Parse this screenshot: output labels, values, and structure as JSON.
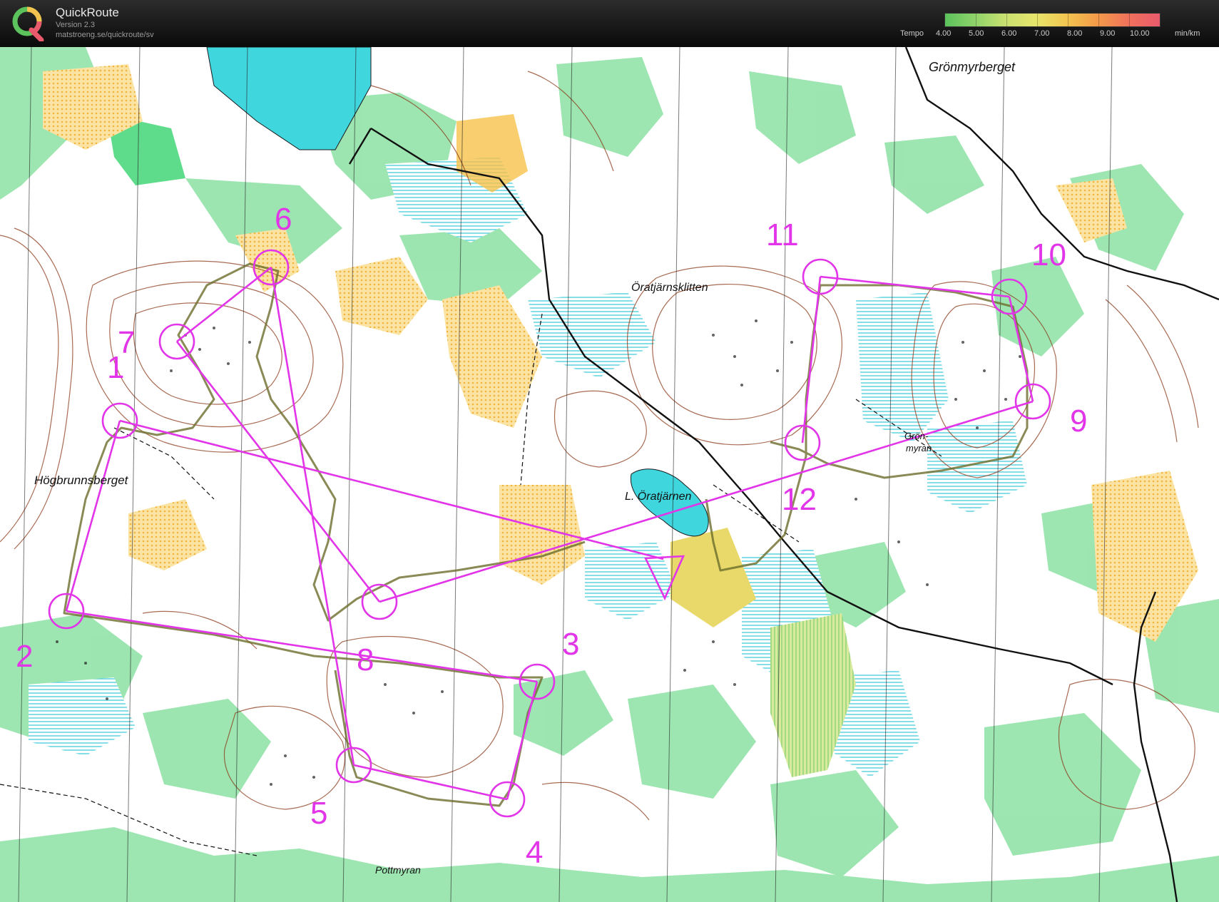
{
  "app": {
    "name": "QuickRoute",
    "version": "Version 2.3",
    "url": "matstroeng.se/quickroute/sv"
  },
  "legend": {
    "title": "Tempo",
    "labels": [
      "4.00",
      "5.00",
      "6.00",
      "7.00",
      "8.00",
      "9.00",
      "10.00"
    ],
    "unit": "min/km"
  },
  "colors": {
    "course": "#e234e8",
    "water": "#3fd6de",
    "open_land": "#f7c24a",
    "vegetation": "#92e3a9",
    "contour": "#8b3a1a"
  },
  "place_names": {
    "gronmyrberget": "Grönmyrberget",
    "oratjarnsklitten": "Öratjärnsklitten",
    "hogbrunnsberget": "Högbrunnsberget",
    "gron": "Grön-",
    "myran": "myran",
    "l_oratjarnen": "L. Öratjärnen",
    "pottmyran": "Pottmyran"
  },
  "course": {
    "start_symbol": "triangle",
    "controls": [
      {
        "number": "1"
      },
      {
        "number": "2"
      },
      {
        "number": "3"
      },
      {
        "number": "4"
      },
      {
        "number": "5"
      },
      {
        "number": "6"
      },
      {
        "number": "7"
      },
      {
        "number": "8"
      },
      {
        "number": "9"
      },
      {
        "number": "10"
      },
      {
        "number": "11"
      },
      {
        "number": "12"
      }
    ]
  }
}
